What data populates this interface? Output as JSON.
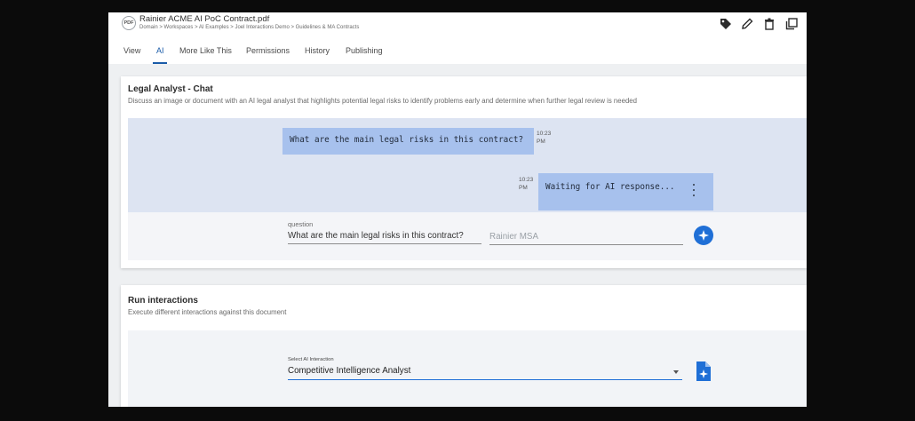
{
  "header": {
    "pdf_icon_text": "PDF",
    "title": "Rainier ACME AI PoC Contract.pdf",
    "breadcrumb": "Domain > Workspaces > AI Examples > Joel Interactions Demo > Guidelines & MA Contracts",
    "tools": [
      "tag-icon",
      "pencil-icon",
      "trash-icon",
      "copy-icon"
    ]
  },
  "tabs": [
    {
      "label": "View"
    },
    {
      "label": "AI",
      "active": true
    },
    {
      "label": "More Like This"
    },
    {
      "label": "Permissions"
    },
    {
      "label": "History"
    },
    {
      "label": "Publishing"
    }
  ],
  "chat": {
    "title": "Legal Analyst - Chat",
    "subtitle": "Discuss an image or document with an AI legal analyst that highlights potential legal risks to identify problems early and determine when further legal review is needed",
    "messages": [
      {
        "role": "user",
        "text": "What are the main legal risks in this contract?",
        "time_hm": "10:23",
        "time_ampm": "PM"
      },
      {
        "role": "ai",
        "text": "Waiting for AI response...",
        "time_hm": "10:23",
        "time_ampm": "PM"
      }
    ],
    "question_label": "question",
    "question_value": "What are the main legal risks in this contract?",
    "context_placeholder": "Rainier MSA"
  },
  "run": {
    "title": "Run interactions",
    "subtitle": "Execute different interactions against this document",
    "select_label": "Select AI Interaction",
    "select_value": "Competitive Intelligence Analyst"
  },
  "colors": {
    "accent": "#1f6fd6",
    "bubble": "#a7c1ed",
    "active_tab": "#1a5ba8"
  }
}
